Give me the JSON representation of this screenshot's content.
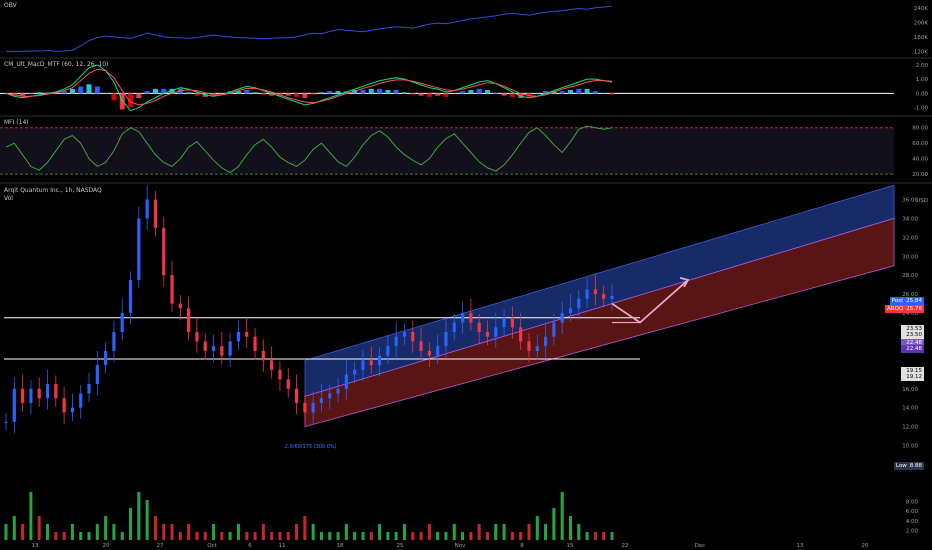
{
  "panes": {
    "obv": {
      "title": "OBV"
    },
    "macd": {
      "title": "CM_Ult_MacD_MTF (60, 12, 26, 10)"
    },
    "mfi": {
      "title": "MFI (14)"
    },
    "main": {
      "title": "Arqit Quantum Inc., 1h, NASDAQ",
      "subtitle": "Vol"
    }
  },
  "regression_label": "-2.0/60/175 (300.0%)",
  "price_tags": [
    {
      "label": "Post",
      "value": "25.84",
      "color": "#2962ff"
    },
    {
      "label": "ARQQ",
      "value": "25.76",
      "color": "#f23645"
    },
    {
      "label": "",
      "value": "23.53",
      "color": "#e0e0e0"
    },
    {
      "label": "",
      "value": "23.50",
      "color": "#e0e0e0"
    },
    {
      "label": "",
      "value": "22.48",
      "color": "#7e57c2"
    },
    {
      "label": "",
      "value": "22.48",
      "color": "#5e35b1"
    },
    {
      "label": "",
      "value": "19.15",
      "color": "#e0e0e0"
    },
    {
      "label": "",
      "value": "19.12",
      "color": "#e0e0e0"
    },
    {
      "label": "Low",
      "value": "8.88",
      "color": "#2a3350"
    }
  ],
  "colors": {
    "background": "#000000",
    "up": "#2962ff",
    "down": "#f23645",
    "channel_upper": "#1e3a8a",
    "channel_lower": "#7f1d1d",
    "obv_line": "#2f4fd8",
    "mfi_line": "#43a047",
    "arrow": "#e7a6c8"
  },
  "chart_data": [
    {
      "type": "line",
      "title": "OBV",
      "yticks": [
        "240K",
        "200K",
        "160K",
        "120K"
      ],
      "ylim": [
        110,
        245
      ],
      "units": "K",
      "series": [
        {
          "values": [
            120,
            120,
            120,
            121,
            121,
            122,
            120,
            121,
            123,
            135,
            150,
            158,
            162,
            160,
            158,
            156,
            163,
            170,
            165,
            160,
            158,
            157,
            156,
            158,
            162,
            165,
            162,
            160,
            158,
            157,
            156,
            155,
            156,
            157,
            158,
            160,
            166,
            170,
            168,
            175,
            180,
            178,
            176,
            174,
            178,
            182,
            185,
            188,
            186,
            184,
            190,
            195,
            198,
            196,
            200,
            205,
            210,
            212,
            215,
            218,
            222,
            225,
            222,
            220,
            224,
            228,
            230,
            232,
            235,
            238,
            236,
            240,
            242,
            245
          ]
        }
      ]
    },
    {
      "type": "line",
      "title": "CM_Ult_MacD_MTF (60, 12, 26, 10)",
      "yticks": [
        "2.00",
        "1.00",
        "0.00",
        "-1.00"
      ],
      "ylim": [
        -1.3,
        2.2
      ],
      "series": [
        {
          "values": [
            0.0,
            -0.2,
            -0.3,
            -0.2,
            -0.1,
            0.0,
            0.1,
            0.3,
            0.6,
            1.2,
            1.8,
            2.0,
            1.6,
            0.8,
            -0.5,
            -1.2,
            -1.0,
            -0.6,
            -0.3,
            0.0,
            0.2,
            0.4,
            0.3,
            0.1,
            -0.1,
            -0.2,
            -0.1,
            0.1,
            0.3,
            0.5,
            0.4,
            0.2,
            0.0,
            -0.2,
            -0.4,
            -0.6,
            -0.8,
            -0.7,
            -0.5,
            -0.3,
            -0.1,
            0.1,
            0.3,
            0.5,
            0.7,
            0.9,
            1.0,
            1.1,
            1.0,
            0.8,
            0.6,
            0.4,
            0.3,
            0.1,
            0.2,
            0.4,
            0.6,
            0.8,
            0.9,
            0.7,
            0.4,
            0.1,
            -0.2,
            -0.3,
            -0.2,
            0.0,
            0.2,
            0.4,
            0.6,
            0.8,
            1.0,
            1.0,
            0.9,
            0.8
          ]
        },
        {
          "values": [
            0.0,
            -0.1,
            -0.2,
            -0.2,
            -0.15,
            -0.05,
            0.05,
            0.2,
            0.4,
            0.9,
            1.4,
            1.7,
            1.6,
            1.1,
            0.2,
            -0.6,
            -0.8,
            -0.7,
            -0.5,
            -0.2,
            0.0,
            0.2,
            0.25,
            0.2,
            0.05,
            -0.1,
            -0.1,
            0.0,
            0.2,
            0.35,
            0.35,
            0.25,
            0.1,
            -0.1,
            -0.3,
            -0.45,
            -0.6,
            -0.65,
            -0.55,
            -0.4,
            -0.2,
            0.0,
            0.15,
            0.35,
            0.5,
            0.7,
            0.85,
            0.95,
            0.95,
            0.85,
            0.7,
            0.55,
            0.4,
            0.25,
            0.2,
            0.3,
            0.45,
            0.6,
            0.75,
            0.7,
            0.5,
            0.25,
            0.0,
            -0.15,
            -0.2,
            -0.1,
            0.1,
            0.3,
            0.45,
            0.6,
            0.8,
            0.9,
            0.9,
            0.85
          ]
        }
      ]
    },
    {
      "type": "line",
      "title": "MFI (14)",
      "yticks": [
        "80.00",
        "60.00",
        "40.00",
        "20.00"
      ],
      "ylim": [
        15,
        90
      ],
      "hlines": [
        80,
        20
      ],
      "series": [
        {
          "values": [
            55,
            60,
            45,
            30,
            25,
            35,
            50,
            65,
            70,
            60,
            40,
            30,
            35,
            50,
            72,
            80,
            75,
            60,
            45,
            35,
            30,
            40,
            55,
            62,
            50,
            38,
            28,
            22,
            30,
            45,
            58,
            65,
            55,
            42,
            35,
            30,
            38,
            52,
            60,
            48,
            36,
            30,
            42,
            58,
            70,
            76,
            68,
            55,
            45,
            38,
            32,
            40,
            55,
            66,
            72,
            60,
            48,
            36,
            28,
            24,
            32,
            45,
            60,
            74,
            80,
            70,
            58,
            48,
            62,
            78,
            82,
            80,
            78,
            80
          ]
        }
      ]
    },
    {
      "type": "line",
      "title": "Arqit Quantum Inc., 1h, NASDAQ",
      "ylabel": "USD",
      "ylim": [
        9,
        37
      ],
      "yticks": [
        "36.00",
        "34.00",
        "32.00",
        "30.00",
        "28.00",
        "26.00",
        "24.00",
        "22.00",
        "20.00",
        "18.00",
        "16.00",
        "14.00",
        "12.00",
        "10.00"
      ],
      "x_ticks": [
        "13",
        "20",
        "27",
        "Oct",
        "6",
        "11",
        "18",
        "25",
        "Nov",
        "8",
        "15",
        "22",
        "Dec",
        "13",
        "20"
      ],
      "series": [
        {
          "values": [
            12.5,
            16.0,
            14.5,
            16.0,
            15.0,
            16.5,
            15.0,
            13.5,
            14.0,
            15.5,
            16.5,
            18.5,
            20.0,
            22.0,
            24.0,
            27.5,
            34.0,
            36.0,
            33.0,
            28.0,
            25.0,
            24.5,
            22.0,
            21.0,
            20.0,
            20.5,
            19.5,
            21.0,
            22.0,
            21.5,
            20.0,
            19.0,
            18.0,
            17.0,
            16.0,
            14.5,
            13.5,
            14.5,
            15.0,
            15.5,
            16.0,
            17.5,
            18.0,
            19.0,
            18.5,
            19.5,
            20.5,
            21.5,
            22.0,
            21.0,
            20.0,
            19.5,
            20.5,
            22.0,
            23.0,
            24.0,
            23.0,
            22.0,
            21.5,
            22.5,
            23.5,
            22.5,
            21.0,
            20.0,
            20.5,
            21.5,
            23.0,
            24.0,
            24.5,
            25.5,
            26.5,
            26.0,
            25.5,
            25.8
          ]
        }
      ],
      "hlines": [
        23.5,
        19.15
      ],
      "channel": {
        "start_low": 12.0,
        "start_mid": 15.2,
        "start_high": 19.0,
        "end_low": 29.0,
        "end_mid": 34.0,
        "end_high": 37.5
      },
      "arrow_path": [
        25.0,
        23.0,
        27.5
      ],
      "volume_yticks": [
        "8.00",
        "6.00",
        "4.00",
        "2.00"
      ],
      "volume": [
        2,
        3,
        2,
        6,
        3,
        2,
        1,
        1,
        2,
        1,
        1,
        2,
        3,
        2,
        1,
        4,
        6,
        5,
        3,
        2,
        2,
        1,
        2,
        1,
        1,
        2,
        1,
        1,
        2,
        1,
        1,
        2,
        1,
        1,
        1,
        2,
        3,
        2,
        1,
        1,
        1,
        2,
        1,
        1,
        1,
        2,
        1,
        1,
        2,
        1,
        1,
        2,
        1,
        1,
        2,
        1,
        1,
        2,
        1,
        2,
        2,
        1,
        1,
        2,
        3,
        2,
        4,
        6,
        3,
        2,
        1,
        1,
        1,
        1
      ]
    }
  ]
}
